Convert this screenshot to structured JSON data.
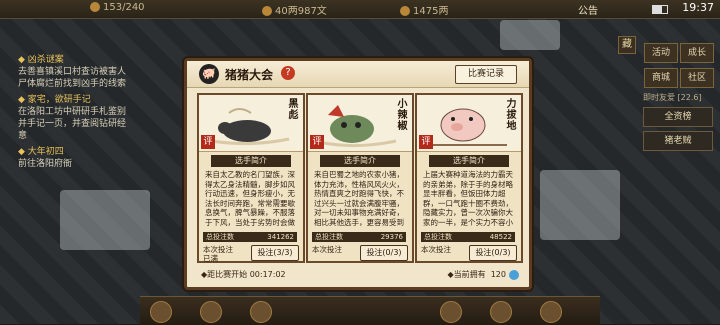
{
  "topbar": {
    "stat1": "153/240",
    "stat2": "40两987文",
    "stat3": "1475两",
    "gonggao": "公告",
    "time": "19:37"
  },
  "quest": [
    {
      "title": "◆ 凶杀谜案",
      "body": "去善喜镇溪口村查访被害人尸体腐烂前找到凶手的线索"
    },
    {
      "title": "◆ 家宅，欲研手记",
      "body": "在洛阳工坊中研研手札鉴别并手记一页，并查阅钻研经意"
    },
    {
      "title": "◆ 大年初四",
      "body": "前往洛阳府衙"
    }
  ],
  "rightmenu": {
    "buttons": [
      "活动",
      "成长",
      "商城",
      "社区"
    ],
    "cang": "藏",
    "tags": "即时友爱 [22.6]",
    "list": [
      "全资榜",
      "猪老贼"
    ]
  },
  "modal": {
    "title": "猪猪大会",
    "help": "?",
    "record_button": "比赛记录",
    "bio_header": "选手简介",
    "votes_label": "总投注数",
    "this_label": "本次投注",
    "cards": [
      {
        "name": "黑彪",
        "bio": "来自太乙教的名门望族，深得太乙身法精髓，脚步如风行动迅速，但身形瘦小，无法长时间奔跑，常常需要歇息换气，脾气暴躁，不服落于下风，当处于劣势时会做出难以预测的行为。",
        "votes": "341262",
        "this_status": "已满",
        "vote_button": "投注(3/3)"
      },
      {
        "name": "小辣椒",
        "bio": "来自巴蜀之地的农家小猪，体力充沛，性格风风火火，热情直爽之时跑得飞快，不过兴头一过就会满腹牢骚，对一切未知事物充满好奇，相比其他选手，更容易受到外界的影响。",
        "votes": "29376",
        "this_status": "",
        "vote_button": "投注(0/3)"
      },
      {
        "name": "力拔地",
        "bio": "上届大赛种道海法的力霸天的亲弟弟，除于手的身材略显丰胖看，但饭田体力超群，一口气跑十圈不费劲，隐藏实力，曾一次次骗你大家的一半，是个实力不容小觑的选手。",
        "votes": "48522",
        "this_status": "",
        "vote_button": "投注(0/3)"
      }
    ],
    "footer_left": "◆距比赛开始 00:17:02",
    "footer_right": "◆当前拥有",
    "owned": "120"
  }
}
